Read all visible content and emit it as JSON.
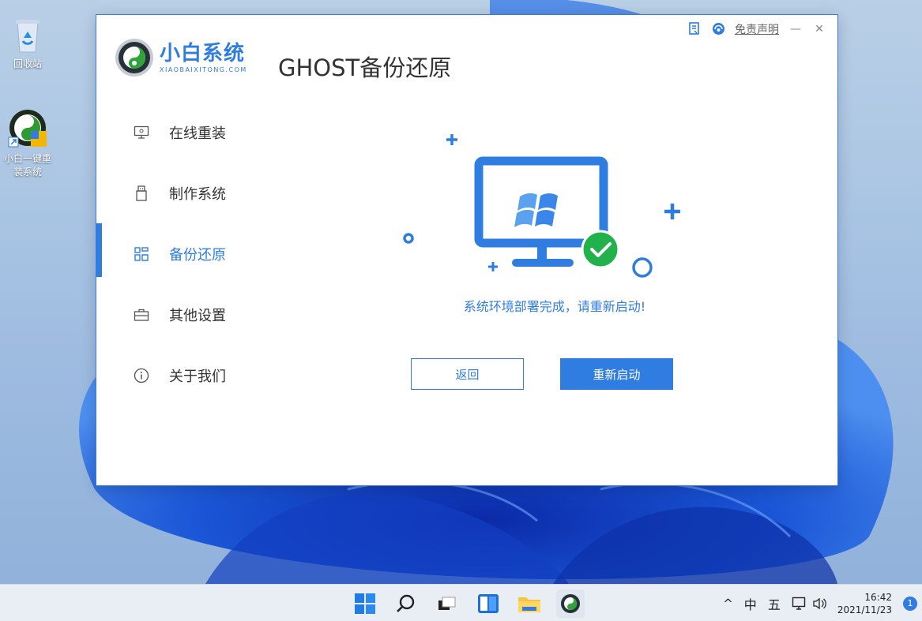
{
  "desktop": {
    "icons": [
      {
        "label": "回收站",
        "icon": "recycle-bin-icon"
      },
      {
        "label": "小白一键重装系统",
        "icon": "xiaobai-app-icon"
      }
    ]
  },
  "app": {
    "brand_name": "小白系统",
    "brand_sub": "XIAOBAIXITONG.COM",
    "page_title": "GHOST备份还原",
    "disclaimer": "免责声明",
    "minimize": "—",
    "close": "✕",
    "nav": [
      {
        "label": "在线重装",
        "icon": "monitor-icon",
        "active": false
      },
      {
        "label": "制作系统",
        "icon": "usb-drive-icon",
        "active": false
      },
      {
        "label": "备份还原",
        "icon": "backup-grid-icon",
        "active": true
      },
      {
        "label": "其他设置",
        "icon": "briefcase-icon",
        "active": false
      },
      {
        "label": "关于我们",
        "icon": "info-icon",
        "active": false
      }
    ],
    "status_message": "系统环境部署完成，请重新启动!",
    "back_label": "返回",
    "restart_label": "重新启动",
    "accent_color": "#2f7de1",
    "success_color": "#22b24c"
  },
  "taskbar": {
    "ime_lang": "中",
    "ime_mode": "五",
    "time": "16:42",
    "date": "2021/11/23",
    "notification_count": "1"
  }
}
